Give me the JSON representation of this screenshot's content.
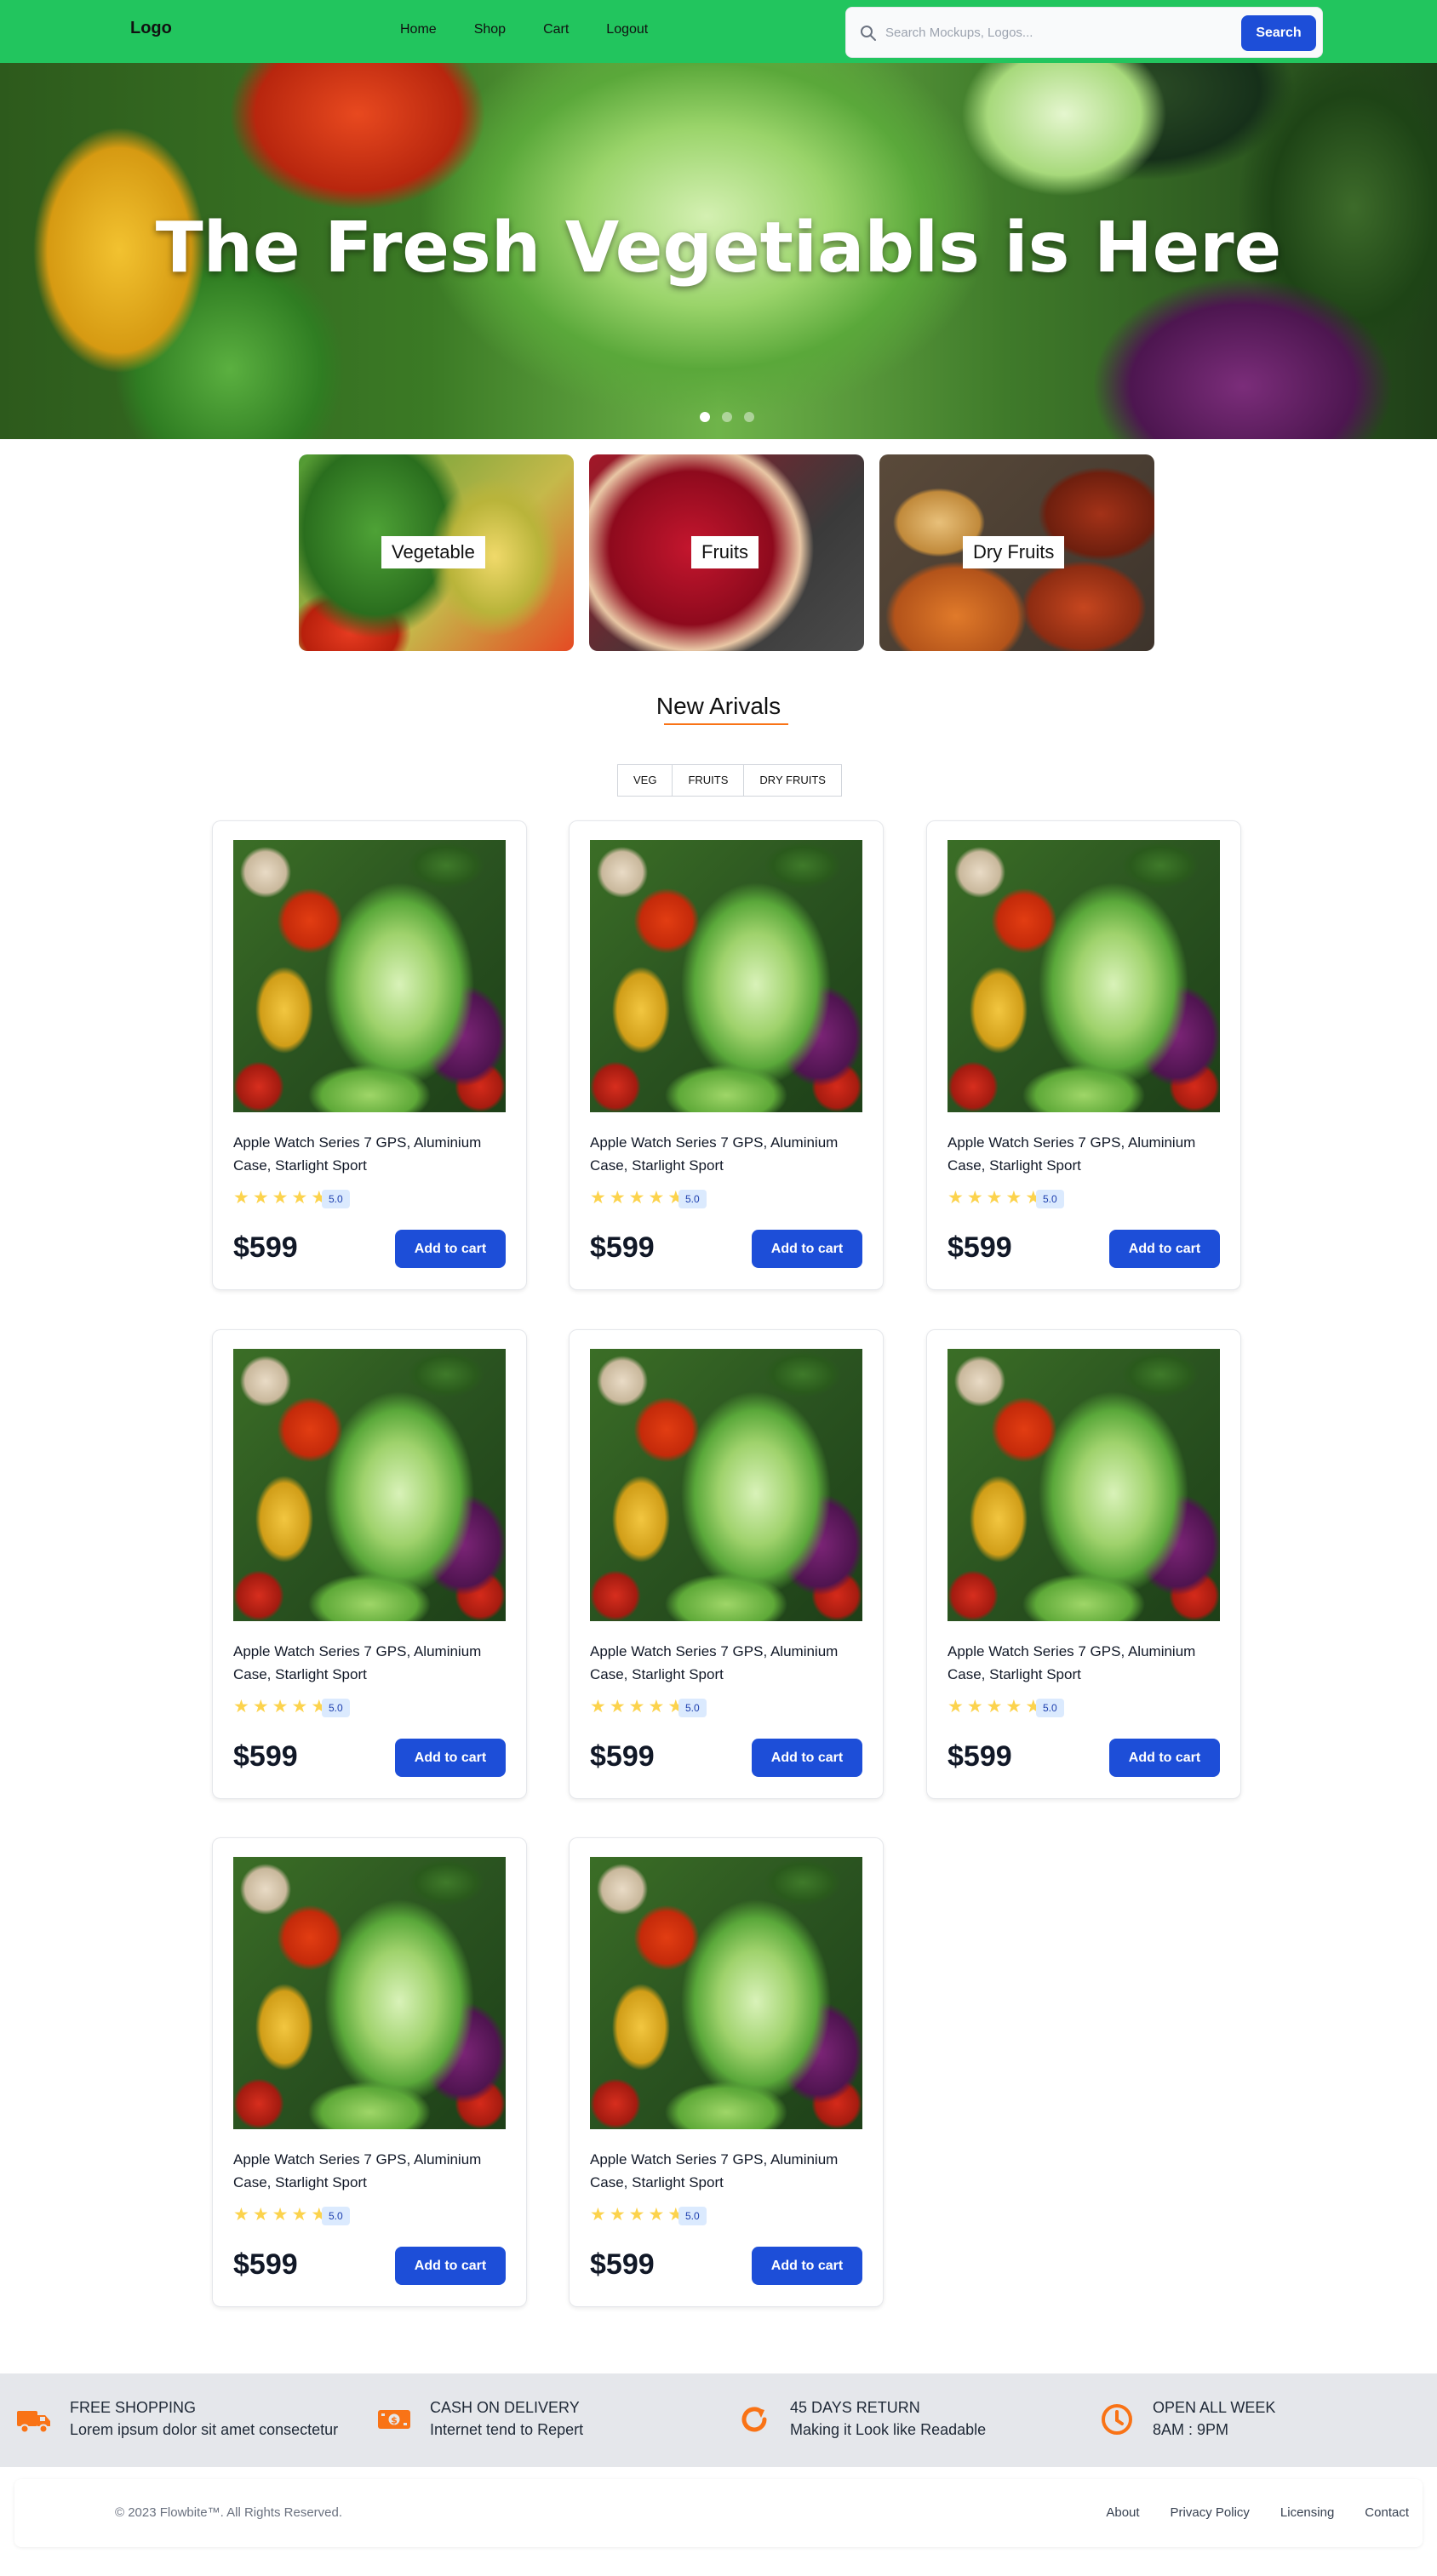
{
  "navbar": {
    "logo": "Logo",
    "links": [
      "Home",
      "Shop",
      "Cart",
      "Logout"
    ],
    "search_placeholder": "Search Mockups, Logos...",
    "search_button": "Search"
  },
  "hero": {
    "title": "The Fresh Vegetiabls is Here",
    "slides": 3,
    "active_slide": 1
  },
  "categories": [
    "Vegetable",
    "Fruits",
    "Dry Fruits"
  ],
  "section": {
    "title": "New Arivals",
    "tabs": [
      "VEG",
      "FRUITS",
      "DRY FRUITS"
    ]
  },
  "products": [
    {
      "title": "Apple Watch Series 7 GPS, Aluminium Case, Starlight Sport",
      "rating": "5.0",
      "stars": 5,
      "price": "$599",
      "button": "Add to cart"
    },
    {
      "title": "Apple Watch Series 7 GPS, Aluminium Case, Starlight Sport",
      "rating": "5.0",
      "stars": 5,
      "price": "$599",
      "button": "Add to cart"
    },
    {
      "title": "Apple Watch Series 7 GPS, Aluminium Case, Starlight Sport",
      "rating": "5.0",
      "stars": 5,
      "price": "$599",
      "button": "Add to cart"
    },
    {
      "title": "Apple Watch Series 7 GPS, Aluminium Case, Starlight Sport",
      "rating": "5.0",
      "stars": 5,
      "price": "$599",
      "button": "Add to cart"
    },
    {
      "title": "Apple Watch Series 7 GPS, Aluminium Case, Starlight Sport",
      "rating": "5.0",
      "stars": 5,
      "price": "$599",
      "button": "Add to cart"
    },
    {
      "title": "Apple Watch Series 7 GPS, Aluminium Case, Starlight Sport",
      "rating": "5.0",
      "stars": 5,
      "price": "$599",
      "button": "Add to cart"
    },
    {
      "title": "Apple Watch Series 7 GPS, Aluminium Case, Starlight Sport",
      "rating": "5.0",
      "stars": 5,
      "price": "$599",
      "button": "Add to cart"
    },
    {
      "title": "Apple Watch Series 7 GPS, Aluminium Case, Starlight Sport",
      "rating": "5.0",
      "stars": 5,
      "price": "$599",
      "button": "Add to cart"
    }
  ],
  "features": [
    {
      "icon": "truck-icon",
      "title": "FREE SHOPPING",
      "subtitle": "Lorem ipsum dolor sit amet consectetur"
    },
    {
      "icon": "cash-icon",
      "title": "CASH ON DELIVERY",
      "subtitle": "Internet tend to Repert"
    },
    {
      "icon": "return-icon",
      "title": "45 DAYS RETURN",
      "subtitle": "Making it Look like Readable"
    },
    {
      "icon": "clock-icon",
      "title": "OPEN ALL WEEK",
      "subtitle": "8AM : 9PM"
    }
  ],
  "footer": {
    "copyright": "© 2023 Flowbite™. All Rights Reserved.",
    "links": [
      "About",
      "Privacy Policy",
      "Licensing",
      "Contact"
    ]
  },
  "colors": {
    "navbar": "#22c55e",
    "button": "#1d4ed8",
    "accent": "#f97316",
    "star": "#fcd34d"
  }
}
